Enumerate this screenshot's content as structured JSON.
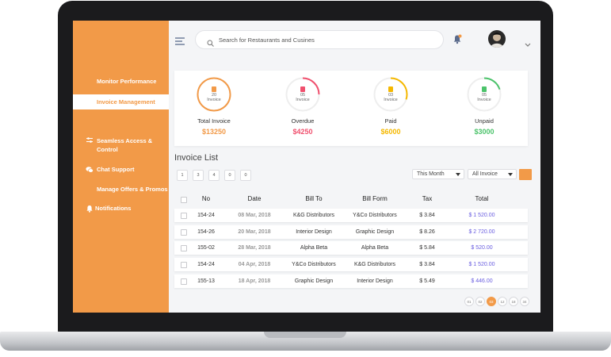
{
  "colors": {
    "accent": "#f29a48",
    "overdue": "#f0506e",
    "paid": "#f5b800",
    "unpaid": "#4cc36b",
    "total_link": "#6a5ee0"
  },
  "search": {
    "placeholder": "Search for Restaurants and Cusines"
  },
  "sidebar": {
    "items": [
      {
        "label": "Monitor Performance",
        "icon": "none",
        "active": false
      },
      {
        "label": "Invoice Management",
        "icon": "none",
        "active": true
      },
      {
        "label": "Seamless Access &",
        "label2": "Control",
        "icon": "sliders-icon",
        "active": false
      },
      {
        "label": "Chat Support",
        "icon": "chat-icon",
        "active": false
      },
      {
        "label": "Manage Offers & Promos",
        "icon": "none",
        "active": false
      },
      {
        "label": "Notifications",
        "icon": "bell-icon",
        "active": false
      }
    ]
  },
  "summary": [
    {
      "count": "20",
      "unit": "Invoice",
      "label": "Total Invoice",
      "amount": "$13250",
      "fill": 1.0
    },
    {
      "count": "05",
      "unit": "Invoice",
      "label": "Overdue",
      "amount": "$4250",
      "fill": 0.25
    },
    {
      "count": "03",
      "unit": "Invoice",
      "label": "Paid",
      "amount": "$6000",
      "fill": 0.3
    },
    {
      "count": "05",
      "unit": "Invoice",
      "label": "Unpaid",
      "amount": "$3000",
      "fill": 0.2
    }
  ],
  "list": {
    "title": "Invoice List",
    "filters": [
      "1",
      "3",
      "4",
      "0",
      "0"
    ],
    "period": "This Month",
    "type": "All Invoice",
    "columns": [
      "No",
      "Date",
      "Bill To",
      "Bill Form",
      "Tax",
      "Total"
    ],
    "rows": [
      {
        "no": "154-24",
        "date": "08 Mar, 2018",
        "bill_to": "K&G Distributors",
        "bill_from": "Y&Co Distributors",
        "tax": "$ 3.84",
        "total": "$ 1 520.00"
      },
      {
        "no": "154-26",
        "date": "20 Mar, 2018",
        "bill_to": "Interior Design",
        "bill_from": "Graphic Design",
        "tax": "$ 8.26",
        "total": "$ 2 720.00"
      },
      {
        "no": "155-02",
        "date": "28 Mar, 2018",
        "bill_to": "Alpha Beta",
        "bill_from": "Alpha Beta",
        "tax": "$ 5.84",
        "total": "$ 520.00"
      },
      {
        "no": "154-24",
        "date": "04 Apr, 2018",
        "bill_to": "Y&Co Distributors",
        "bill_from": "K&G Distributors",
        "tax": "$ 3.84",
        "total": "$ 1 520.00"
      },
      {
        "no": "155-13",
        "date": "18 Apr, 2018",
        "bill_to": "Graphic Design",
        "bill_from": "Interior Design",
        "tax": "$ 5.49",
        "total": "$ 446.00"
      }
    ],
    "pages": [
      "01",
      "02",
      "03",
      "12",
      "18",
      "34"
    ],
    "current_page": "03"
  }
}
